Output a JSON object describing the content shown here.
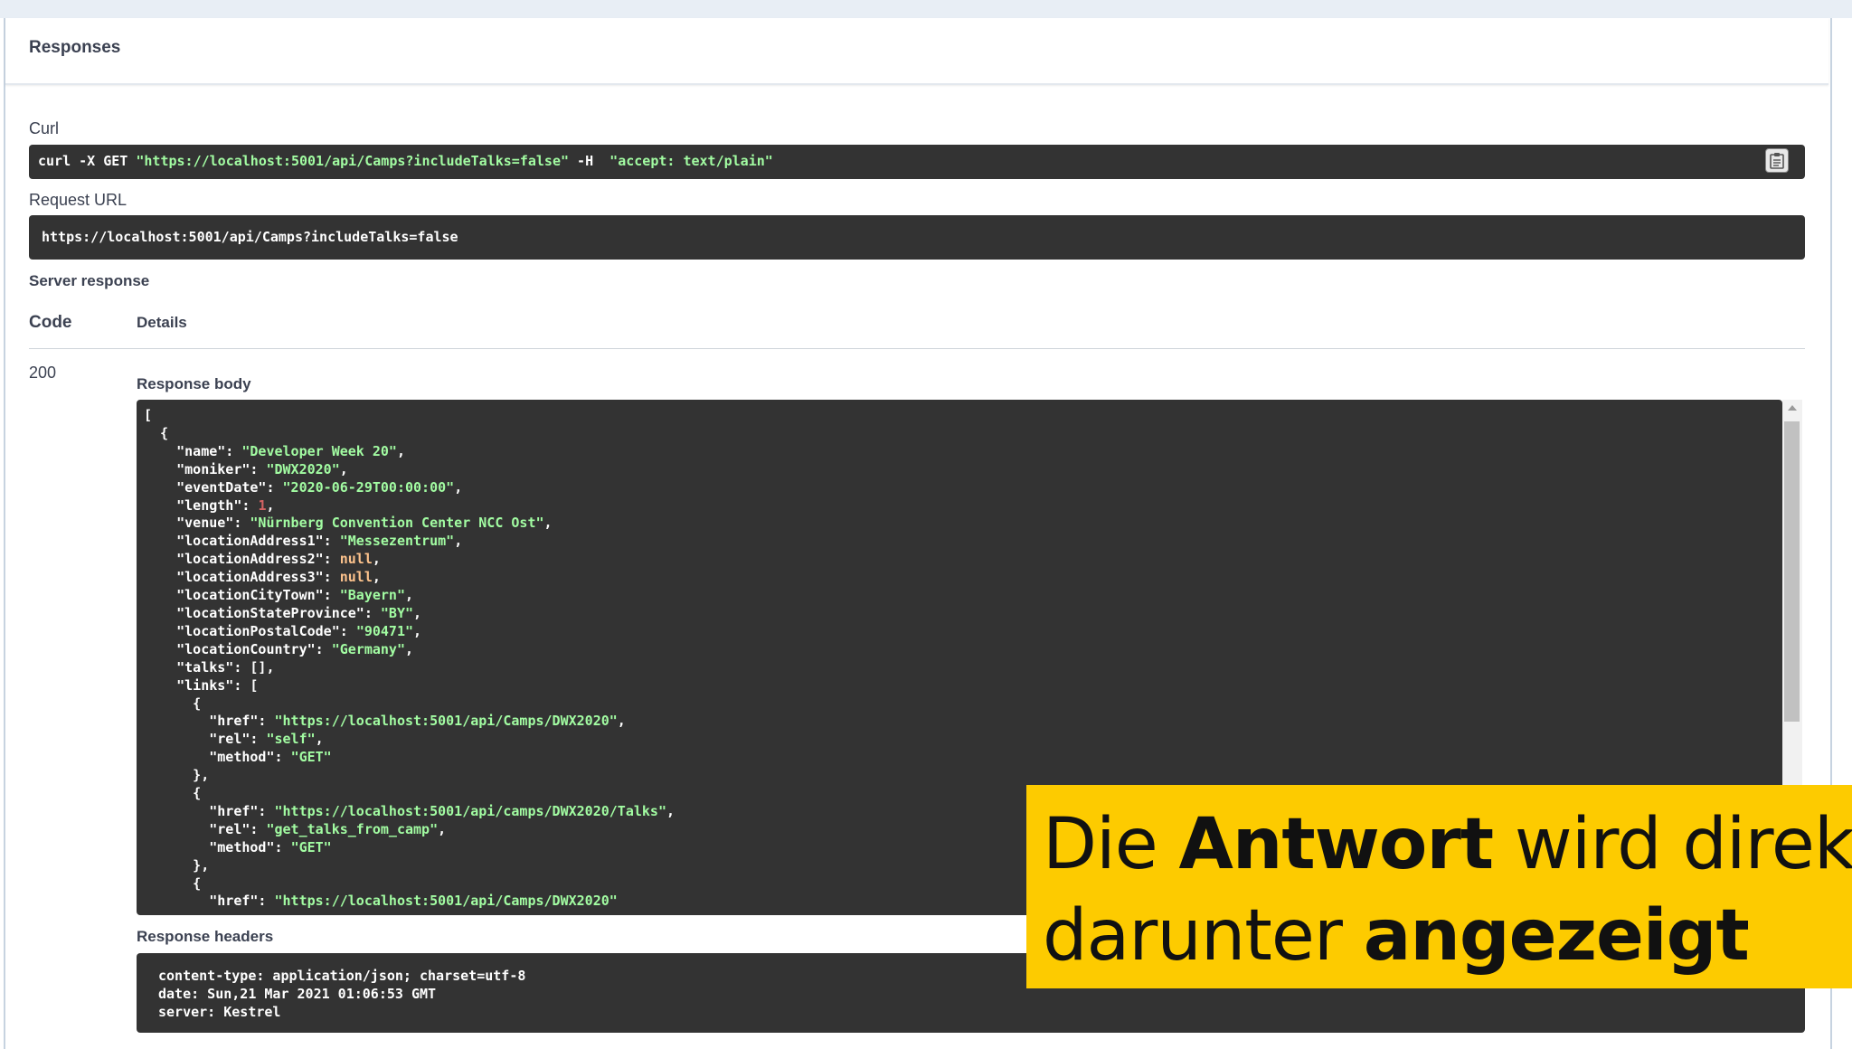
{
  "responses_title": "Responses",
  "curl": {
    "label": "Curl",
    "command_prefix": "curl -X GET ",
    "url": "\"https://localhost:5001/api/Camps?includeTalks=false\"",
    "flag": " -H  ",
    "header": "\"accept: text/plain\""
  },
  "request_url": {
    "label": "Request URL",
    "value": "https://localhost:5001/api/Camps?includeTalks=false"
  },
  "server_response": {
    "label": "Server response",
    "col_code": "Code",
    "col_details": "Details",
    "code": "200",
    "body_label": "Response body",
    "headers_label": "Response headers"
  },
  "response_body": [
    {
      "name": "Developer Week 20",
      "moniker": "DWX2020",
      "eventDate": "2020-06-29T00:00:00",
      "length": 1,
      "venue": "Nürnberg Convention Center NCC Ost",
      "locationAddress1": "Messezentrum",
      "locationAddress2": null,
      "locationAddress3": null,
      "locationCityTown": "Bayern",
      "locationStateProvince": "BY",
      "locationPostalCode": "90471",
      "locationCountry": "Germany",
      "talks": [],
      "links": [
        {
          "href": "https://localhost:5001/api/Camps/DWX2020",
          "rel": "self",
          "method": "GET"
        },
        {
          "href": "https://localhost:5001/api/camps/DWX2020/Talks",
          "rel": "get_talks_from_camp",
          "method": "GET"
        },
        {
          "href": "https://localhost:5001/api/Camps/DWX2020"
        }
      ]
    }
  ],
  "response_headers": [
    "content-type: application/json; charset=utf-8",
    "date: Sun,21 Mar 2021 01:06:53 GMT",
    "server: Kestrel"
  ],
  "overlay": {
    "line1_a": "Die ",
    "line1_b": "Antwort",
    "line1_c": " wird direkt",
    "line2_a": "darunter ",
    "line2_b": "angezeigt"
  },
  "icons": {
    "copy": "clipboard-icon"
  },
  "colors": {
    "code_bg": "#333333",
    "string": "#a2fca2",
    "number": "#d36363",
    "null": "#fcc28c",
    "overlay_bg": "#fdcb00"
  }
}
